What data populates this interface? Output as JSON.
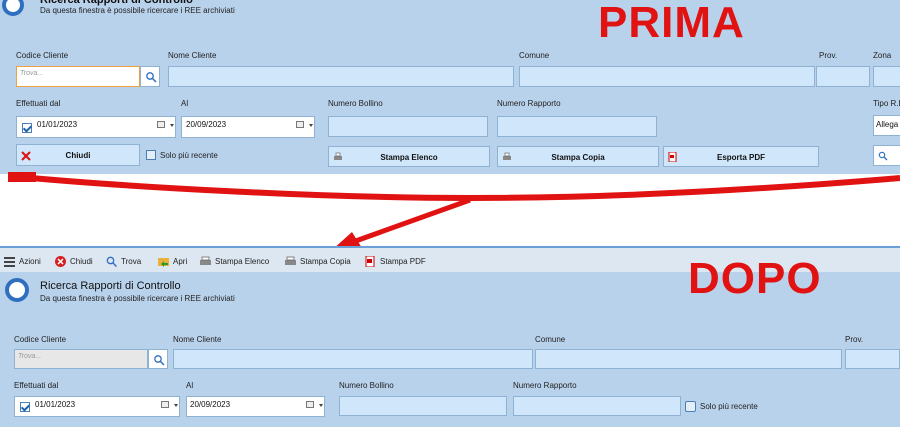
{
  "annotations": {
    "before": "PRIMA",
    "after": "DOPO"
  },
  "window": {
    "title": "Ricerca Rapporti di Controllo",
    "subtitle": "Da questa finestra è possibile ricercare i REE archiviati"
  },
  "toolbar": {
    "menu": "Azioni",
    "close": "Chiudi",
    "find": "Trova",
    "open": "Apri",
    "print_list": "Stampa Elenco",
    "print_copy": "Stampa Copia",
    "print_pdf": "Stampa PDF"
  },
  "form": {
    "codice_cliente_label": "Codice Cliente",
    "codice_cliente_placeholder": "Trova...",
    "nome_cliente_label": "Nome Cliente",
    "comune_label": "Comune",
    "prov_label": "Prov.",
    "zona_label": "Zona",
    "effettuati_dal_label": "Effettuati dal",
    "effettuati_dal_value": "01/01/2023",
    "al_label": "Al",
    "al_value_before": "20/09/2023",
    "al_value_after": "20/09/2023",
    "numero_bollino_label": "Numero Bollino",
    "numero_rapporto_label": "Numero Rapporto",
    "tipo_label": "Tipo R.E",
    "tipo_value": "Allega",
    "solo_piu_recente_label": "Solo più recente"
  },
  "buttons": {
    "chiudi": "Chiudi",
    "stampa_elenco": "Stampa Elenco",
    "stampa_copia": "Stampa Copia",
    "esporta_pdf": "Esporta PDF"
  },
  "colors": {
    "panel": "#b9d2ec",
    "annotation_red": "#e11212",
    "accent": "#2f6fc0"
  }
}
